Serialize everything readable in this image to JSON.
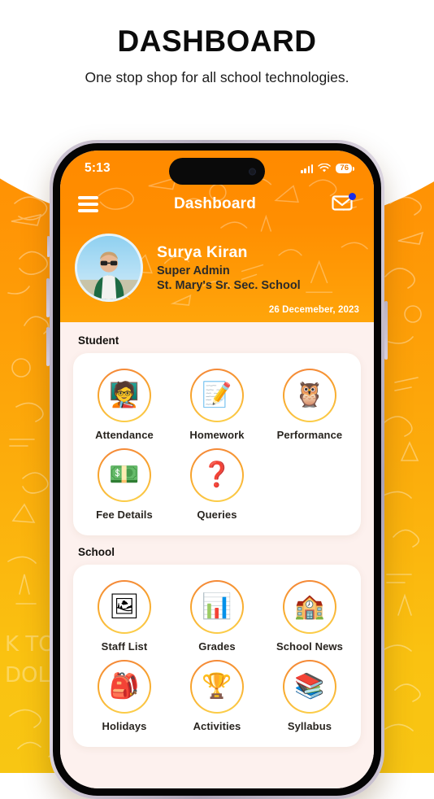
{
  "promo": {
    "title": "DASHBOARD",
    "subtitle": "One stop shop for all school technologies."
  },
  "phone": {
    "status_bar": {
      "time": "5:13",
      "signal_icon": "signal-bars-icon",
      "wifi_icon": "wifi-icon",
      "battery_level": "76"
    },
    "navbar": {
      "menu_icon": "hamburger-menu-icon",
      "title": "Dashboard",
      "mail_icon": "mail-envelope-icon",
      "notification_dot_color": "#1B2BE8"
    },
    "profile": {
      "avatar_icon": "user-avatar",
      "name": "Surya Kiran",
      "role": "Super Admin",
      "school": "St. Mary's Sr. Sec. School",
      "date": "26 Decemeber, 2023"
    },
    "sections": [
      {
        "label": "Student",
        "rows": [
          [
            {
              "label": "Attendance",
              "icon": "classroom-students-icon",
              "glyph": "🧑‍🏫"
            },
            {
              "label": "Homework",
              "icon": "notebook-pencil-icon",
              "glyph": "📝"
            },
            {
              "label": "Performance",
              "icon": "owl-pencil-icon",
              "glyph": "🦉"
            }
          ],
          [
            {
              "label": "Fee Details",
              "icon": "money-envelope-icon",
              "glyph": "💵"
            },
            {
              "label": "Queries",
              "icon": "question-books-icon",
              "glyph": "❓"
            }
          ]
        ]
      },
      {
        "label": "School",
        "rows": [
          [
            {
              "label": "Staff List",
              "icon": "staff-photos-icon",
              "glyph": "🖼"
            },
            {
              "label": "Grades",
              "icon": "blackboard-easel-icon",
              "glyph": "📊"
            },
            {
              "label": "School News",
              "icon": "school-building-icon",
              "glyph": "🏫"
            }
          ],
          [
            {
              "label": "Holidays",
              "icon": "backpack-icon",
              "glyph": "🎒"
            },
            {
              "label": "Activities",
              "icon": "trophy-icon",
              "glyph": "🏆"
            },
            {
              "label": "Syllabus",
              "icon": "stacked-books-icon",
              "glyph": "📚"
            }
          ]
        ]
      }
    ]
  },
  "theme": {
    "orange": "#FF8A00",
    "yellow": "#F8C613",
    "app_bg": "#fdf1ee",
    "card_bg": "#ffffff"
  }
}
